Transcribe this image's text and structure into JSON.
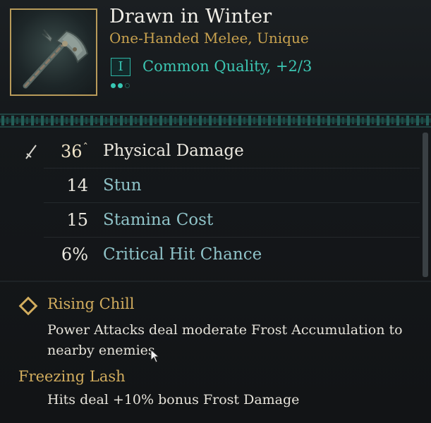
{
  "item": {
    "name": "Drawn in Winter",
    "type": "One-Handed Melee, Unique",
    "quality_tier": "I",
    "quality_label": "Common Quality, +2/3",
    "quality_pips_filled": 2,
    "quality_pips_total": 3
  },
  "stats": [
    {
      "value": "36",
      "label": "Physical Damage",
      "increase": true
    },
    {
      "value": "14",
      "label": "Stun",
      "increase": false
    },
    {
      "value": "15",
      "label": "Stamina Cost",
      "increase": false
    },
    {
      "value": "6%",
      "label": "Critical Hit Chance",
      "increase": false
    }
  ],
  "perks": [
    {
      "name": "Rising Chill",
      "description": "Power Attacks deal moderate Frost Accumulation to nearby enemies"
    },
    {
      "name": "Freezing Lash",
      "description": "Hits deal +10% bonus Frost Damage"
    }
  ],
  "icons": {
    "weapon": "axe-icon",
    "damage_stat": "sword-icon",
    "perk": "diamond-icon",
    "pointer": "mouse-cursor-icon"
  },
  "colors": {
    "gold": "#c9a24f",
    "teal": "#3cc6b2",
    "stat_label": "#8fc3c8",
    "frame": "#b89b5a"
  }
}
